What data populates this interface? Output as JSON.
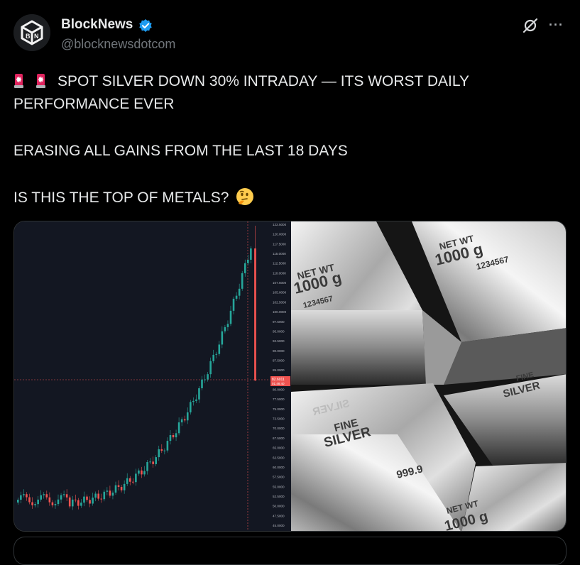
{
  "author": {
    "display_name": "BlockNews",
    "handle": "@blocknewsdotcom",
    "avatar_icon": "blocknews-logo-icon",
    "verified_icon": "verified-badge-icon",
    "verified_color": "#1d9bf0"
  },
  "actions": {
    "grok_icon": "grok-icon",
    "more_label": "···"
  },
  "tweet": {
    "line1": "SPOT SILVER DOWN 30% INTRADAY — ITS WORST DAILY",
    "line2": "PERFORMANCE EVER",
    "line3": "ERASING ALL GAINS FROM THE LAST 18 DAYS",
    "line4": "IS THIS THE TOP OF METALS?",
    "emoji_alert": "rotating-light-icon",
    "emoji_thinking": "thinking-face-icon"
  },
  "media": {
    "chart": {
      "price_label": "82.6011",
      "price_sub": "01:48:40",
      "up_color": "#26a69a",
      "down_color": "#ef5350",
      "y_ticks": [
        "122.5000",
        "120.0000",
        "117.5000",
        "115.0000",
        "112.5000",
        "110.0000",
        "107.5000",
        "105.0000",
        "102.5000",
        "100.0000",
        "97.5000",
        "95.0000",
        "92.5000",
        "90.0000",
        "87.5000",
        "85.0000",
        "82.5000",
        "80.0000",
        "77.5000",
        "75.0000",
        "72.5000",
        "70.0000",
        "67.5000",
        "65.0000",
        "62.5000",
        "60.0000",
        "57.5000",
        "55.0000",
        "52.5000",
        "50.0000",
        "47.5000",
        "45.0000"
      ]
    },
    "photo": {
      "bar1_weight": "NET WT",
      "bar1_mass": "1000 g",
      "bar1_serial": "1234567",
      "bar2_weight": "NET WT",
      "bar2_mass": "1000 g",
      "bar2_serial": "1234567",
      "bar3_line1": "FINE",
      "bar3_line2": "SILVER",
      "bar3_purity": "999.9",
      "bar3_weight": "NET WT",
      "bar3_mass": "1000 g",
      "bar4_line1": "FINE",
      "bar4_line2": "SILVER",
      "mirror_text": "SILVER"
    }
  }
}
